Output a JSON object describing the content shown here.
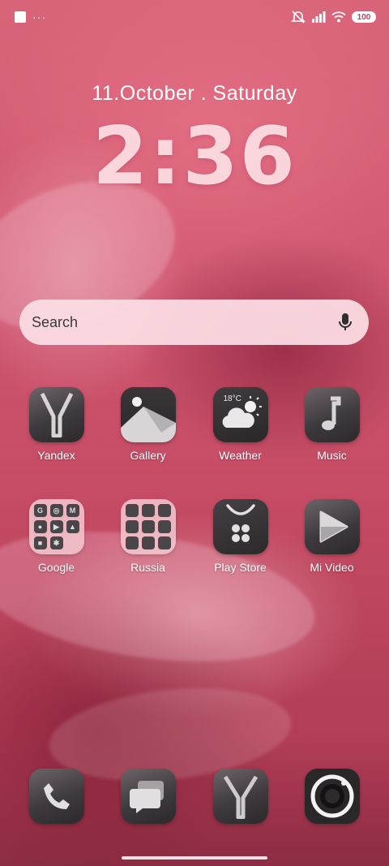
{
  "status_bar": {
    "notification_dots": "···",
    "battery_level": "100",
    "icons": [
      "notification-square-icon",
      "mute-icon",
      "signal-icon",
      "wifi-icon",
      "battery-icon"
    ]
  },
  "lockclock": {
    "date": "11.October . Saturday",
    "time": "2:36"
  },
  "search": {
    "placeholder": "Search"
  },
  "apps": {
    "row1": [
      {
        "label": "Yandex",
        "icon": "yandex-icon"
      },
      {
        "label": "Gallery",
        "icon": "gallery-icon"
      },
      {
        "label": "Weather",
        "icon": "weather-icon",
        "temperature": "18°C"
      },
      {
        "label": "Music",
        "icon": "music-note-icon"
      }
    ],
    "row2": [
      {
        "label": "Google",
        "icon": "google-folder-icon"
      },
      {
        "label": "Russia",
        "icon": "russia-folder-icon"
      },
      {
        "label": "Play Store",
        "icon": "play-store-icon"
      },
      {
        "label": "Mi Video",
        "icon": "play-triangle-icon"
      }
    ]
  },
  "dock": [
    {
      "icon": "phone-icon"
    },
    {
      "icon": "messages-icon"
    },
    {
      "icon": "yandex-browser-icon"
    },
    {
      "icon": "camera-icon"
    }
  ],
  "colors": {
    "wallpaper": "#cf5670",
    "search_bg": "#fcdee4",
    "icon_dark": "#3e3a3d",
    "folder_bg": "#f5c8d0"
  }
}
